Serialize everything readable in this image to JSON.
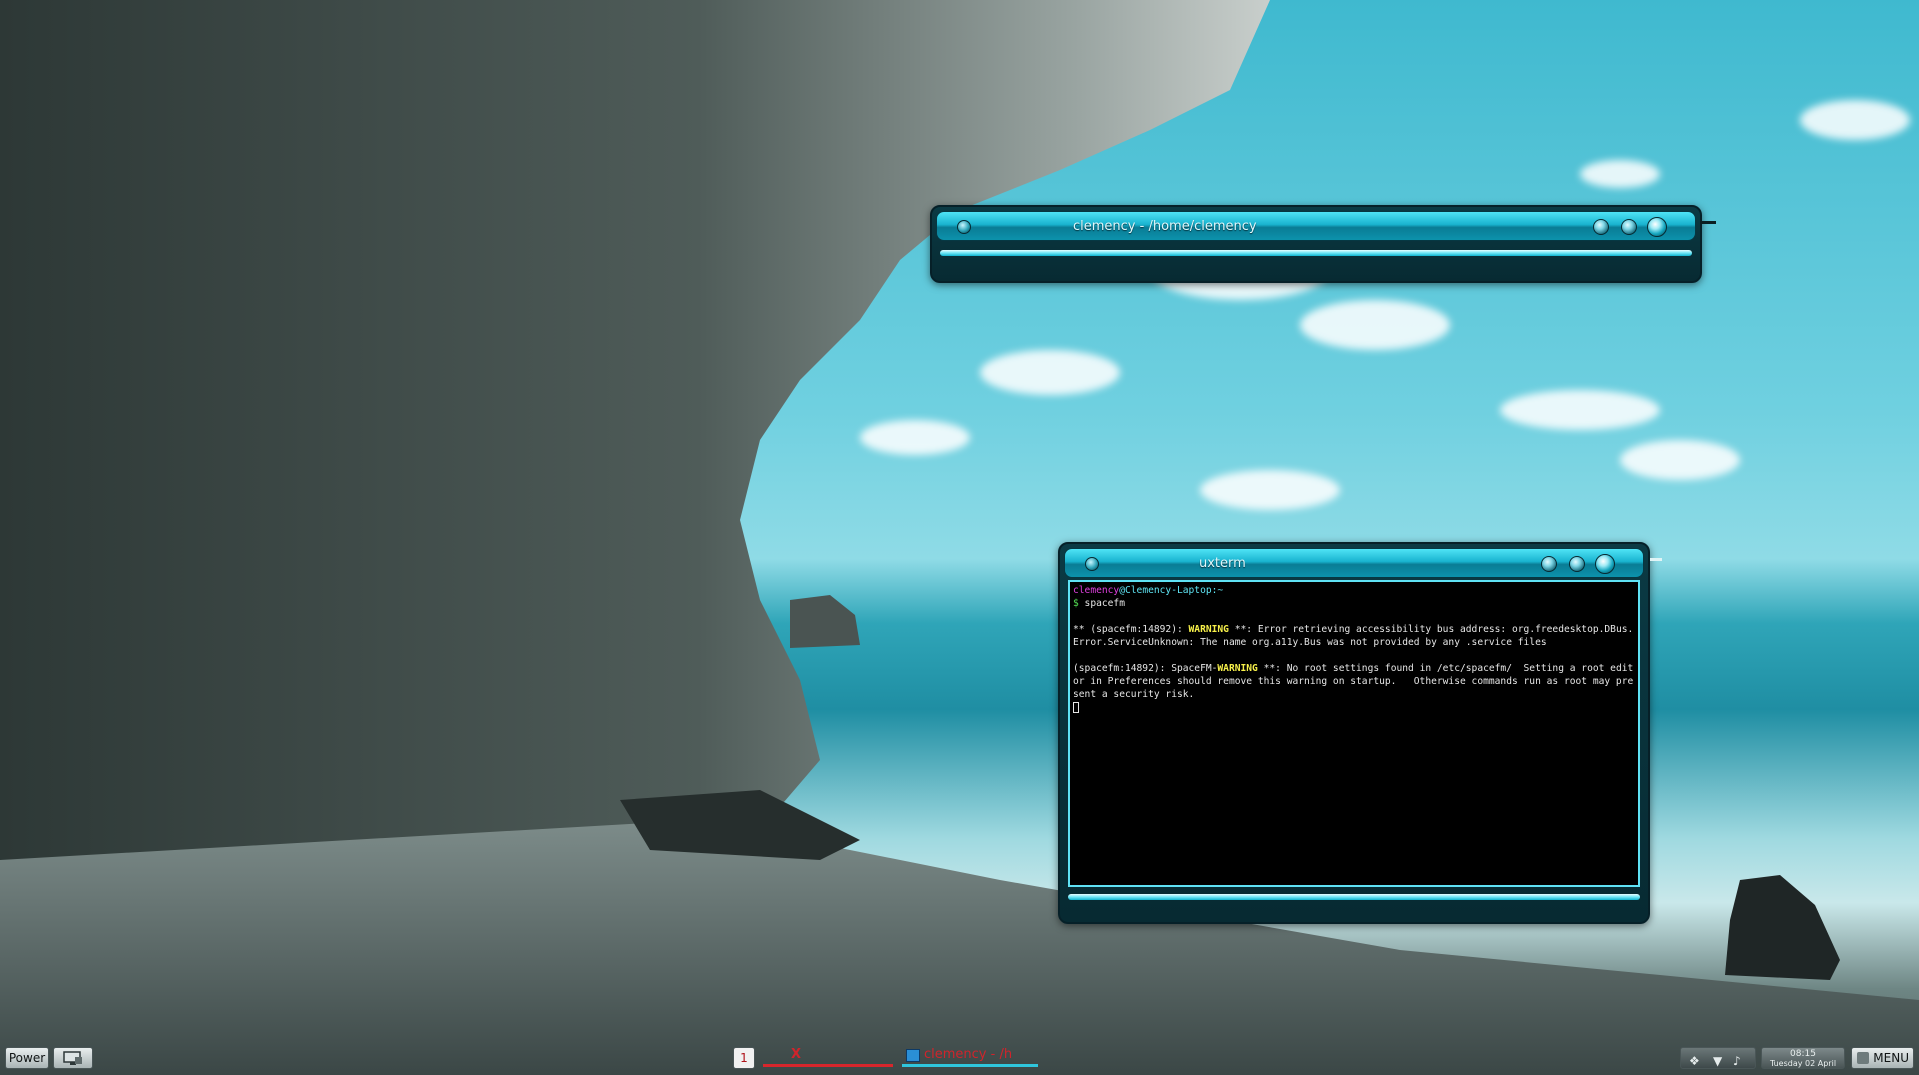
{
  "file_window": {
    "title": "clemency - /home/clemency"
  },
  "terminal_window": {
    "title": "uxterm",
    "prompt_user": "clemency",
    "prompt_host": "@Clemency-Laptop:",
    "prompt_path": "~",
    "prompt_symbol": "$",
    "command": " spacefm",
    "warning1_prefix": "** (spacefm:14892): ",
    "warning1_label": "WARNING",
    "warning1_text": " **: Error retrieving accessibility bus address: org.freedesktop.DBus.Error.ServiceUnknown: The name org.a11y.Bus was not provided by any .service files",
    "warning2_prefix": "(spacefm:14892): SpaceFM-",
    "warning2_label": "WARNING",
    "warning2_text": " **: No root settings found in /etc/spacefm/  Setting a root editor in Preferences should remove this warning on startup.   Otherwise commands run as root may present a security risk."
  },
  "panel": {
    "power_label": "Power",
    "workspace_number": "1",
    "task1_label": "X",
    "task2_label": "clemency - /h",
    "clock_time": "08:15",
    "clock_date": "Tuesday 02 April",
    "menu_label": "MENU"
  },
  "colors": {
    "accent": "#19b3cf",
    "terminal_bg": "#000000",
    "warning": "#f7f04a"
  }
}
